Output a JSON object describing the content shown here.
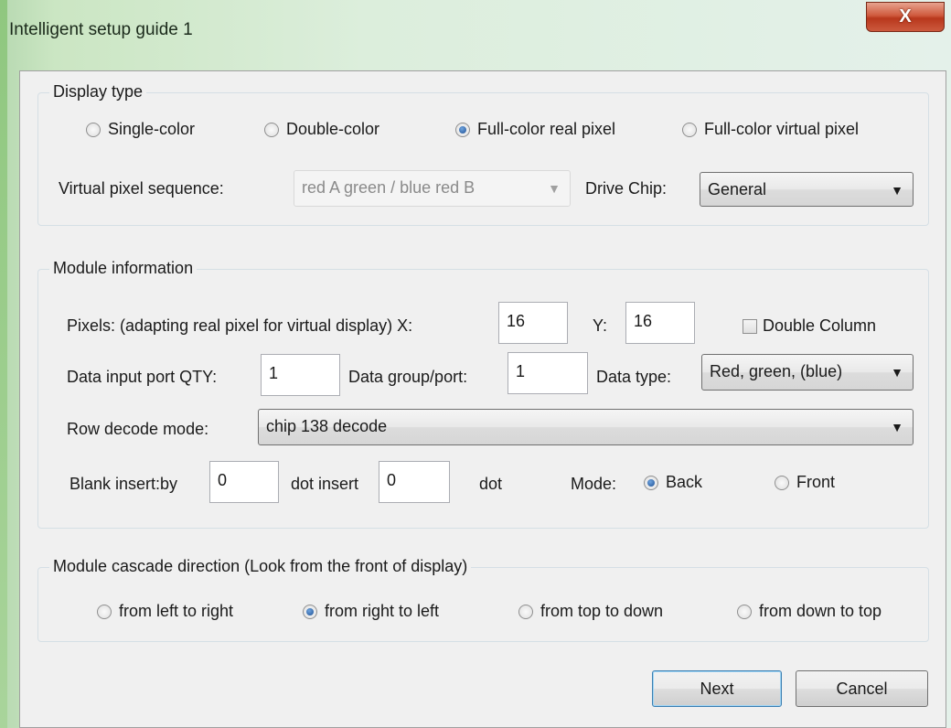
{
  "window": {
    "title": "Intelligent setup guide 1",
    "close_label": "X"
  },
  "display_type": {
    "legend": "Display type",
    "options": [
      {
        "label": "Single-color",
        "selected": false
      },
      {
        "label": "Double-color",
        "selected": false
      },
      {
        "label": "Full-color real pixel",
        "selected": true
      },
      {
        "label": "Full-color virtual pixel",
        "selected": false
      }
    ],
    "virtual_pixel_label": "Virtual pixel sequence:",
    "virtual_pixel_value": "red A green / blue red B",
    "drive_chip_label": "Drive Chip:",
    "drive_chip_value": "General"
  },
  "module_info": {
    "legend": "Module information",
    "pixels_label": "Pixels: (adapting real pixel for virtual display) X:",
    "x_value": "16",
    "y_label": "Y:",
    "y_value": "16",
    "double_column_label": "Double Column",
    "double_column_checked": false,
    "data_input_label": "Data input port QTY:",
    "data_input_value": "1",
    "data_group_label": "Data group/port:",
    "data_group_value": "1",
    "data_type_label": "Data type:",
    "data_type_value": "Red, green, (blue)",
    "row_decode_label": "Row decode mode:",
    "row_decode_value": "chip 138 decode",
    "blank_insert_label": "Blank insert:by",
    "blank_insert_value": "0",
    "dot_insert_label": "dot insert",
    "dot_insert_value": "0",
    "dot_label": "dot",
    "mode_label": "Mode:",
    "mode_options": [
      {
        "label": "Back",
        "selected": true
      },
      {
        "label": "Front",
        "selected": false
      }
    ]
  },
  "cascade": {
    "legend": "Module cascade direction (Look from the front of display)",
    "options": [
      {
        "label": "from left to right",
        "selected": false
      },
      {
        "label": "from right to left",
        "selected": true
      },
      {
        "label": "from top to down",
        "selected": false
      },
      {
        "label": "from down to top",
        "selected": false
      }
    ]
  },
  "buttons": {
    "next": "Next",
    "cancel": "Cancel"
  }
}
